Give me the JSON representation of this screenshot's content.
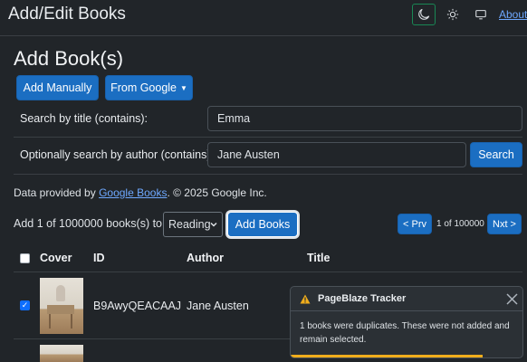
{
  "app": {
    "title": "Add/Edit Books"
  },
  "nav": {
    "about_label": "About"
  },
  "page": {
    "heading": "Add Book(s)"
  },
  "buttons": {
    "add_manually": "Add Manually",
    "from_google": "From Google",
    "search": "Search",
    "add_books": "Add Books",
    "prev": "< Prv",
    "next": "Nxt >"
  },
  "search": {
    "title_label": "Search by title (contains):",
    "title_value": "Emma",
    "author_label": "Optionally search by author (contains):",
    "author_value": "Jane Austen"
  },
  "attribution": {
    "prefix": "Data provided by ",
    "link": "Google Books",
    "suffix": ". © 2025 Google Inc."
  },
  "add_bar": {
    "label": "Add 1 of 1000000 books(s) to:",
    "shelf_selected": "Reading"
  },
  "pagination": {
    "info": "1 of 100000"
  },
  "table": {
    "headers": {
      "cover": "Cover",
      "id": "ID",
      "author": "Author",
      "title": "Title"
    },
    "rows": [
      {
        "id": "B9AwyQEACAAJ",
        "author": "Jane Austen",
        "selected": true
      }
    ]
  },
  "toast": {
    "title": "PageBlaze Tracker",
    "message": "1 books were duplicates. These were not added and remain selected.",
    "progress_percent": 83
  },
  "colors": {
    "primary": "#1b6ec2",
    "background": "#212529",
    "link": "#6ea8fe",
    "warning": "#f0ad1c",
    "active_theme_border": "#198754"
  },
  "icons": [
    "moon-icon",
    "sun-icon",
    "monitor-icon",
    "caret-down-icon",
    "warning-icon",
    "close-icon",
    "check-icon"
  ]
}
